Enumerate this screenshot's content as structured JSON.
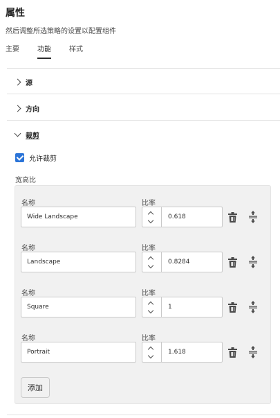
{
  "header": {
    "title": "属性",
    "subtitle": "然后调整所选策略的设置以配置组件"
  },
  "tabs": [
    {
      "label": "主要",
      "active": false
    },
    {
      "label": "功能",
      "active": true
    },
    {
      "label": "样式",
      "active": false
    }
  ],
  "sections": {
    "source": {
      "label": "源",
      "expanded": false
    },
    "orientation": {
      "label": "方向",
      "expanded": false
    },
    "crop": {
      "label": "裁剪",
      "expanded": true
    }
  },
  "crop": {
    "allow_crop_label": "允许裁剪",
    "allow_crop_checked": true,
    "aspect_ratio_label": "宽高比",
    "name_label": "名称",
    "rate_label": "比率",
    "ratios": [
      {
        "name": "Wide Landscape",
        "rate": "0.618"
      },
      {
        "name": "Landscape",
        "rate": "0.8284"
      },
      {
        "name": "Square",
        "rate": "1"
      },
      {
        "name": "Portrait",
        "rate": "1.618"
      }
    ],
    "add_label": "添加"
  },
  "colors": {
    "accent": "#2b74d8",
    "panel_bg": "#f1f1f1",
    "text": "#2c2c2c"
  }
}
